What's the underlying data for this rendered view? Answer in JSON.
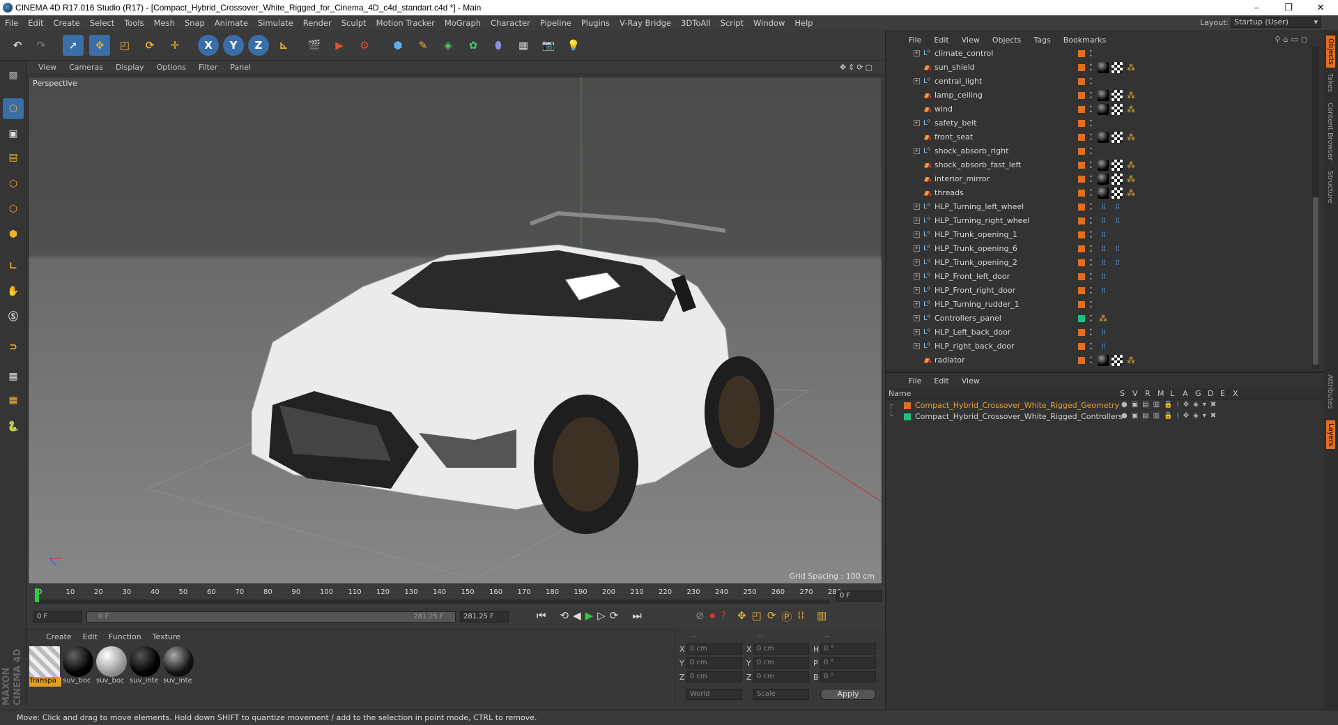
{
  "window": {
    "title": "CINEMA 4D R17.016 Studio (R17) - [Compact_Hybrid_Crossover_White_Rigged_for_Cinema_4D_c4d_standart.c4d *] - Main",
    "minimize": "–",
    "restore": "❐",
    "close": "✕"
  },
  "menu": [
    "File",
    "Edit",
    "Create",
    "Select",
    "Tools",
    "Mesh",
    "Snap",
    "Animate",
    "Simulate",
    "Render",
    "Sculpt",
    "Motion Tracker",
    "MoGraph",
    "Character",
    "Pipeline",
    "Plugins",
    "V-Ray Bridge",
    "3DToAll",
    "Script",
    "Window",
    "Help"
  ],
  "layout": {
    "label": "Layout:",
    "value": "Startup (User)"
  },
  "viewport": {
    "menu": [
      "View",
      "Cameras",
      "Display",
      "Options",
      "Filter",
      "Panel"
    ],
    "label": "Perspective",
    "grid_spacing": "Grid Spacing : 100 cm"
  },
  "timeline": {
    "ticks": [
      "0",
      "10",
      "20",
      "30",
      "40",
      "50",
      "60",
      "70",
      "80",
      "90",
      "100",
      "110",
      "120",
      "130",
      "140",
      "150",
      "160",
      "170",
      "180",
      "190",
      "200",
      "210",
      "220",
      "230",
      "240",
      "250",
      "260",
      "270",
      "280"
    ],
    "frame_display": "0 F",
    "start": "0 F",
    "range_start": "0 F",
    "range_end": "281.25 F",
    "end": "281.25 F"
  },
  "objects": {
    "menu": [
      "File",
      "Edit",
      "View",
      "Objects",
      "Tags",
      "Bookmarks"
    ],
    "rows": [
      {
        "name": "climate_control",
        "type": "null",
        "tags": []
      },
      {
        "name": "sun_shield",
        "type": "bone",
        "tags": [
          "mat",
          "chk",
          "ik"
        ]
      },
      {
        "name": "central_light",
        "type": "null",
        "tags": []
      },
      {
        "name": "lamp_ceiling",
        "type": "bone",
        "tags": [
          "mat",
          "chk",
          "ik"
        ]
      },
      {
        "name": "wind",
        "type": "bone",
        "tags": [
          "mat",
          "chk",
          "ik"
        ]
      },
      {
        "name": "safety_belt",
        "type": "null",
        "tags": []
      },
      {
        "name": "front_seat",
        "type": "bone",
        "tags": [
          "mat",
          "chk",
          "ik"
        ]
      },
      {
        "name": "shock_absorb_right",
        "type": "null",
        "tags": []
      },
      {
        "name": "shock_absorb_fast_left",
        "type": "bone",
        "tags": [
          "mat",
          "chk",
          "ik"
        ]
      },
      {
        "name": "interior_mirror",
        "type": "bone",
        "tags": [
          "mat",
          "chk",
          "ik"
        ]
      },
      {
        "name": "threads",
        "type": "bone",
        "tags": [
          "mat",
          "chk",
          "ik"
        ]
      },
      {
        "name": "HLP_Turning_left_wheel",
        "type": "null",
        "tags": [
          "sel",
          "sel"
        ]
      },
      {
        "name": "HLP_Turning_right_wheel",
        "type": "null",
        "tags": [
          "sel",
          "sel"
        ]
      },
      {
        "name": "HLP_Trunk_opening_1",
        "type": "null",
        "tags": [
          "sel"
        ]
      },
      {
        "name": "HLP_Trunk_opening_6",
        "type": "null",
        "tags": [
          "sel",
          "sel"
        ]
      },
      {
        "name": "HLP_Trunk_opening_2",
        "type": "null",
        "tags": [
          "sel",
          "sel"
        ]
      },
      {
        "name": "HLP_Front_left_door",
        "type": "null",
        "tags": [
          "sel"
        ]
      },
      {
        "name": "HLP_Front_right_door",
        "type": "null",
        "tags": [
          "sel"
        ]
      },
      {
        "name": "HLP_Turning_rudder_1",
        "type": "null",
        "tags": []
      },
      {
        "name": "Controllers_panel",
        "type": "null",
        "tags": [
          "ik"
        ]
      },
      {
        "name": "HLP_Left_back_door",
        "type": "null",
        "tags": [
          "sel"
        ]
      },
      {
        "name": "HLP_right_back_door",
        "type": "null",
        "tags": [
          "sel"
        ]
      },
      {
        "name": "radiator",
        "type": "bone",
        "tags": [
          "mat",
          "chk",
          "ik"
        ]
      }
    ]
  },
  "layers": {
    "menu": [
      "File",
      "Edit",
      "View"
    ],
    "header": {
      "name": "Name",
      "cols": [
        "S",
        "V",
        "R",
        "M",
        "L",
        "A",
        "G",
        "D",
        "E",
        "X"
      ]
    },
    "rows": [
      {
        "name": "Compact_Hybrid_Crossover_White_Rigged_Geometry",
        "color": "#e07020",
        "text_color": "#f0a030"
      },
      {
        "name": "Compact_Hybrid_Crossover_White_Rigged_Controllers",
        "color": "#20c080",
        "text_color": "#d0d0d0"
      }
    ]
  },
  "side_tabs": [
    "Objects",
    "Takes",
    "Content Browser",
    "Structure",
    "Attributes",
    "Layers"
  ],
  "materials": {
    "menu": [
      "Create",
      "Edit",
      "Function",
      "Texture"
    ],
    "items": [
      {
        "label": "Transpa",
        "selected": true
      },
      {
        "label": "suv_boc",
        "selected": false
      },
      {
        "label": "suv_boc",
        "selected": false
      },
      {
        "label": "suv_inte",
        "selected": false
      },
      {
        "label": "suv_inte",
        "selected": false
      }
    ]
  },
  "coords": {
    "headers": [
      "--",
      "--",
      "--"
    ],
    "rows": [
      {
        "a": "X",
        "av": "0 cm",
        "b": "X",
        "bv": "0 cm",
        "c": "H",
        "cv": "0 °"
      },
      {
        "a": "Y",
        "av": "0 cm",
        "b": "Y",
        "bv": "0 cm",
        "c": "P",
        "cv": "0 °"
      },
      {
        "a": "Z",
        "av": "0 cm",
        "b": "Z",
        "bv": "0 cm",
        "c": "B",
        "cv": "0 °"
      }
    ],
    "world": "World",
    "scale": "Scale",
    "apply": "Apply"
  },
  "status": "Move: Click and drag to move elements. Hold down SHIFT to quantize movement / add to the selection in point mode, CTRL to remove.",
  "logo": "MAXON CINEMA 4D",
  "colors": {
    "accent": "#e07020",
    "active_blue": "#3a6ea8",
    "play_green": "#2ecc40"
  }
}
